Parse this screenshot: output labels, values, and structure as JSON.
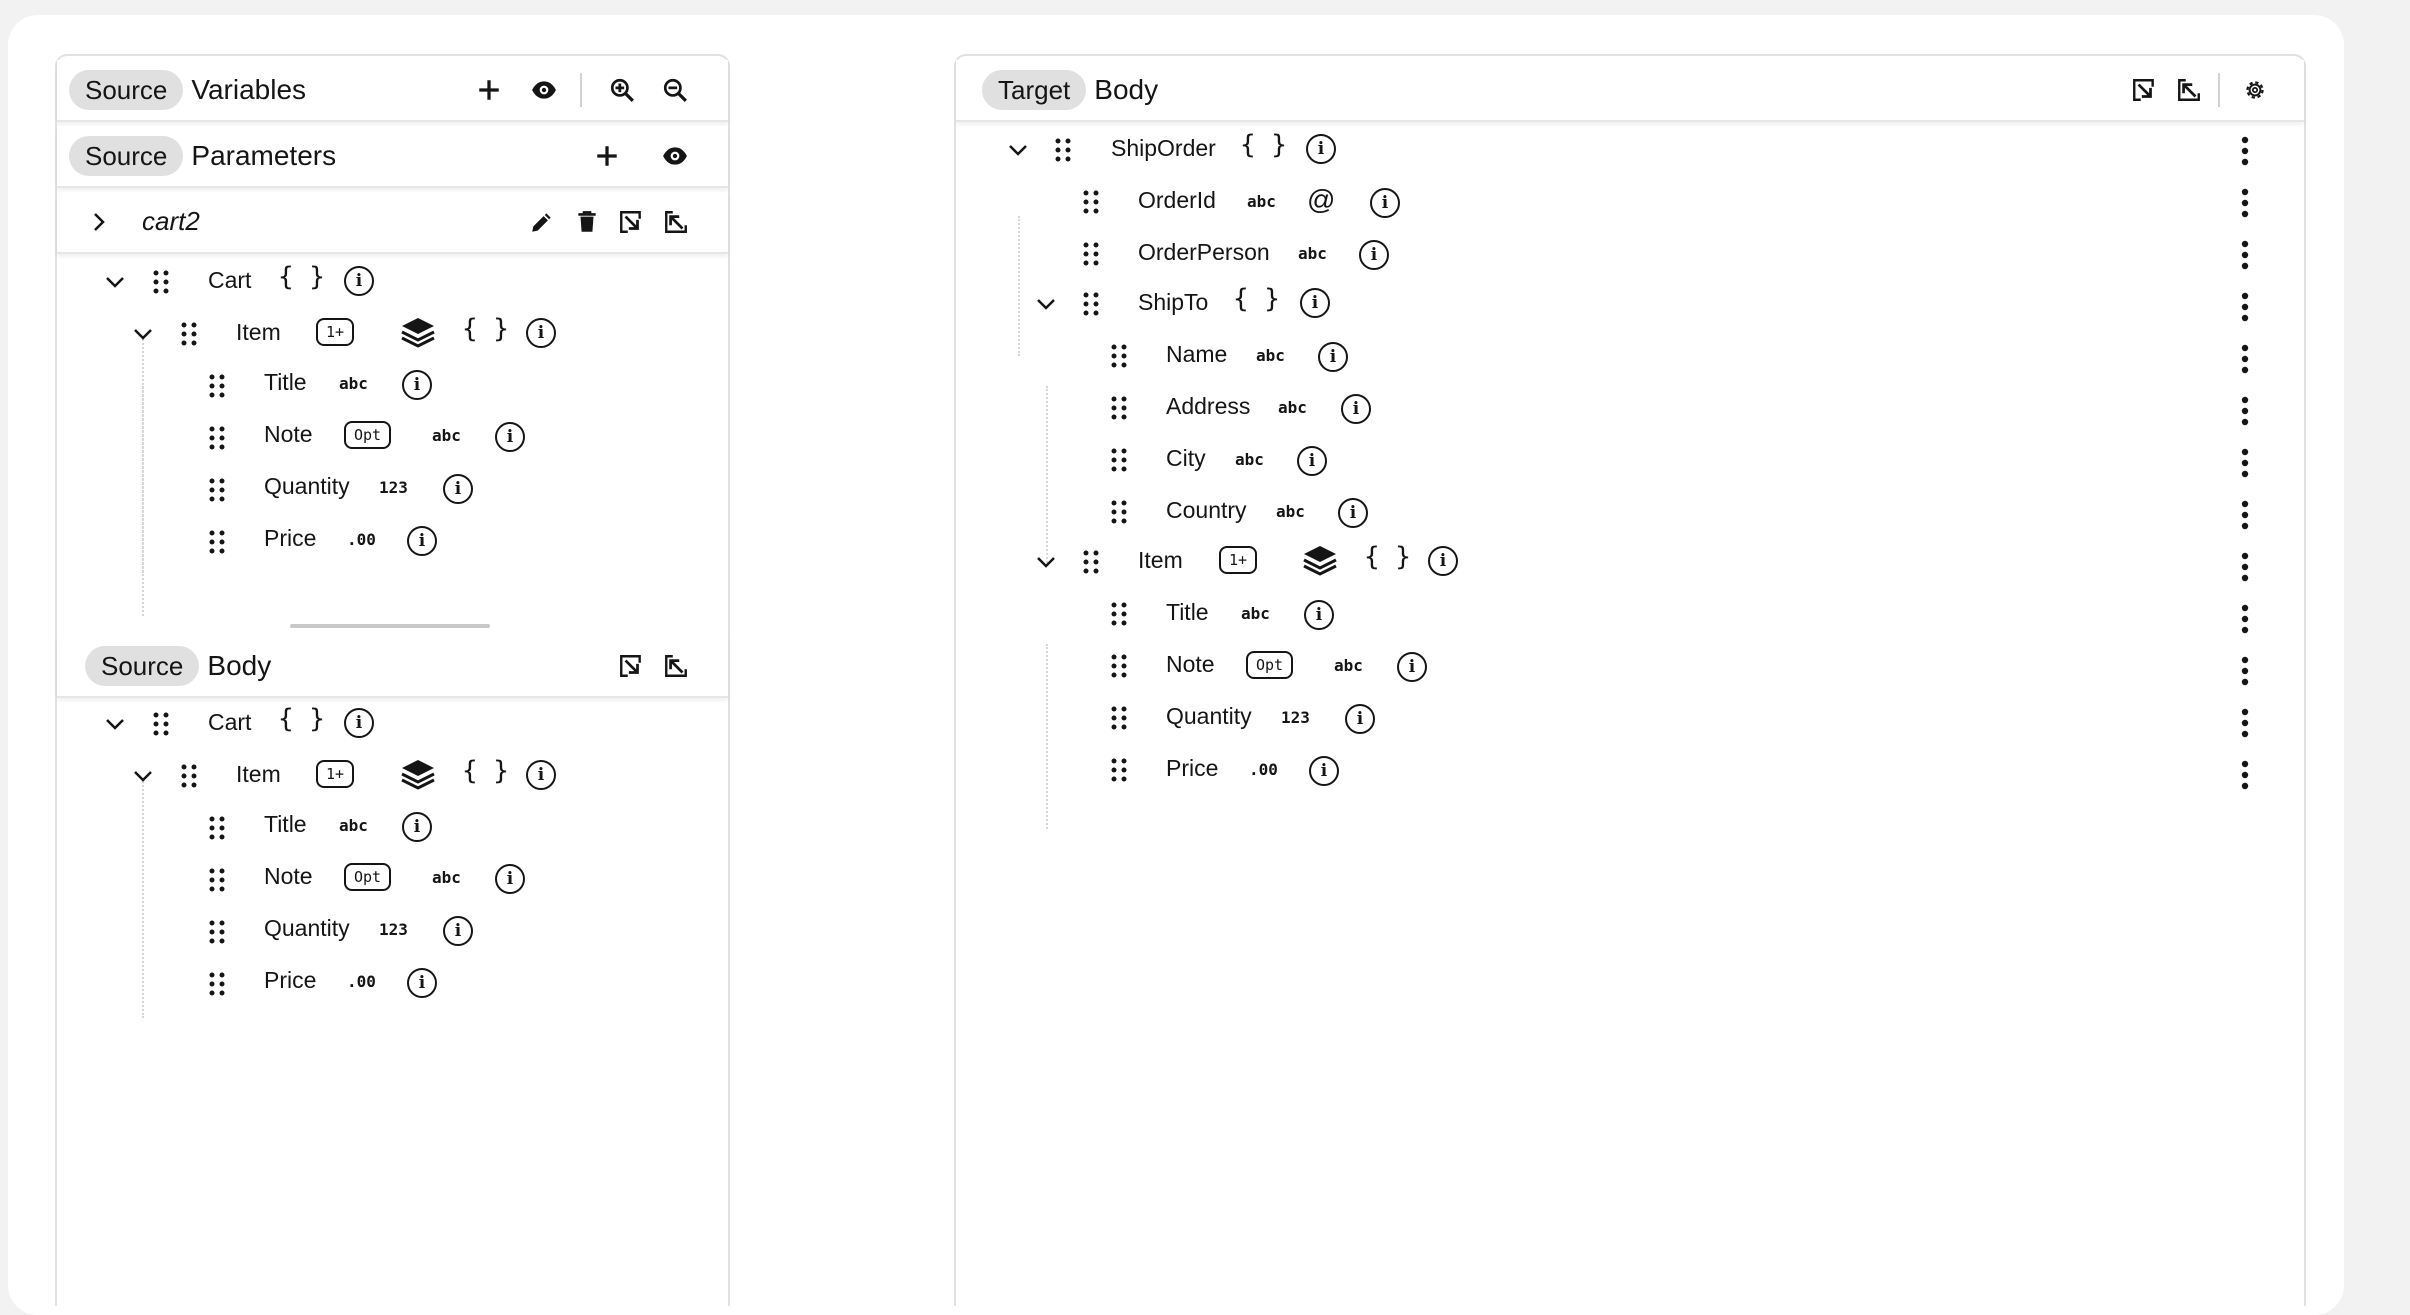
{
  "source_panel": {
    "variables": {
      "chip": "Source",
      "title": "Variables"
    },
    "parameters": {
      "chip": "Source",
      "title": "Parameters"
    },
    "param": {
      "name": "cart2"
    },
    "body": {
      "chip": "Source",
      "title": "Body"
    }
  },
  "target_panel": {
    "header": {
      "chip": "Target",
      "title": "Body"
    }
  },
  "fields": {
    "cart": "Cart",
    "item": "Item",
    "title": "Title",
    "note": "Note",
    "quantity": "Quantity",
    "price": "Price",
    "shiporder": "ShipOrder",
    "orderid": "OrderId",
    "orderperson": "OrderPerson",
    "shipto": "ShipTo",
    "name": "Name",
    "address": "Address",
    "city": "City",
    "country": "Country"
  },
  "types": {
    "object": "{ }",
    "string": "abc",
    "integer": "123",
    "decimal": ".00",
    "attribute": "@",
    "collection": "1+",
    "optional": "Opt",
    "info": "i"
  },
  "icons": [
    "plus-icon",
    "eye-icon",
    "zoom-in-icon",
    "zoom-out-icon",
    "pencil-icon",
    "trash-icon",
    "collapse-all-icon",
    "expand-all-icon",
    "gear-icon",
    "drag-grip-icon",
    "chevron-down-icon",
    "chevron-right-icon",
    "layers-icon",
    "info-icon",
    "kebab-menu-icon"
  ]
}
